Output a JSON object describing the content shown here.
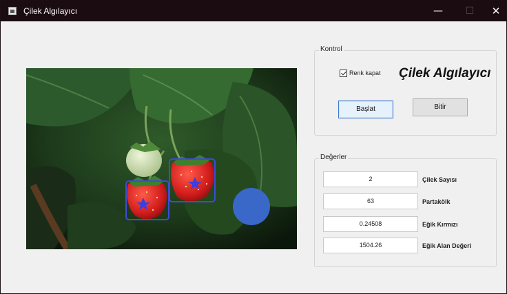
{
  "window": {
    "title": "Çilek Algılayıcı",
    "minimize": "—",
    "maximize": "☐",
    "close": "✕"
  },
  "control": {
    "legend": "Kontrol",
    "checkbox_label": "Renk kapat",
    "checkbox_checked": true,
    "app_title": "Çilek Algılayıcı",
    "start_label": "Başlat",
    "stop_label": "Bitir"
  },
  "values": {
    "legend": "Değerler",
    "rows": [
      {
        "value": "2",
        "label": "Çilek Sayısı"
      },
      {
        "value": "63",
        "label": "Partakölk"
      },
      {
        "value": "0.24508",
        "label": "Eğik Kırmızı"
      },
      {
        "value": "1504.26",
        "label": "Eğik Alan Değeri"
      }
    ]
  },
  "colors": {
    "detection_box": "#3d4bd6",
    "marker": "#3a5fd0",
    "accent_button": "#3d78d0"
  }
}
